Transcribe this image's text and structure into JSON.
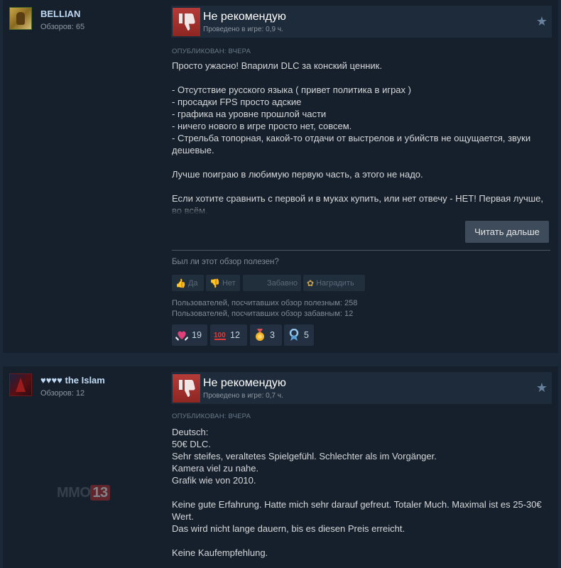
{
  "reviews": [
    {
      "author": "BELLIAN",
      "reviews_count": "Обзоров: 65",
      "verdict": "Не рекомендую",
      "hours": "Проведено в игре: 0,9 ч.",
      "posted": "ОПУБЛИКОВАН: ВЧЕРА",
      "body": [
        "Просто ужасно! Впарили DLC за конский ценник.",
        "- Отсутствие русского языка ( привет политика в играх )\n- просадки FPS просто адские\n- графика на уровне прошлой части\n- ничего нового в игре просто нет, совсем.\n- Стрельба топорная, какой-то отдачи от выстрелов и убийств не ощущается, звуки дешевые.",
        "Лучше поиграю в любимую первую часть, а этого не надо.",
        "Если хотите сравнить с первой и в муках купить, или нет отвечу - НЕТ! Первая лучше, во всём."
      ],
      "read_more": "Читать дальше",
      "helpful_question": "Был ли этот обзор полезен?",
      "votes": {
        "yes": "Да",
        "no": "Нет",
        "funny": "Забавно",
        "award": "Наградить"
      },
      "stats": [
        "Пользователей, посчитавших обзор полезным: 258",
        "Пользователей, посчитавших обзор забавным: 12"
      ],
      "awards": [
        {
          "icon": "heart-hands-icon",
          "count": "19"
        },
        {
          "icon": "hundred-icon",
          "count": "12"
        },
        {
          "icon": "medal-icon",
          "count": "3"
        },
        {
          "icon": "ribbon-icon",
          "count": "5"
        }
      ]
    },
    {
      "author": "♥♥♥♥ the Islam",
      "reviews_count": "Обзоров: 12",
      "verdict": "Не рекомендую",
      "hours": "Проведено в игре: 0,7 ч.",
      "posted": "ОПУБЛИКОВАН: ВЧЕРА",
      "body": [
        "Deutsch:\n50€ DLC.\nSehr steifes, veraltetes Spielgefühl. Schlechter als im Vorgänger.\nKamera viel zu nahe.\nGrafik wie von 2010.",
        "Keine gute Erfahrung. Hatte mich sehr darauf gefreut. Totaler Much. Maximal ist es 25-30€ Wert.\nDas wird nicht lange dauern, bis es diesen Preis erreicht.",
        "Keine Kaufempfehlung."
      ]
    }
  ],
  "watermark": {
    "part1": "MMO",
    "part2": "13"
  },
  "colors": {
    "background": "#1b2838",
    "panel": "#16202d",
    "not_recommended": "#a8302c",
    "text": "#d6d7d8"
  }
}
